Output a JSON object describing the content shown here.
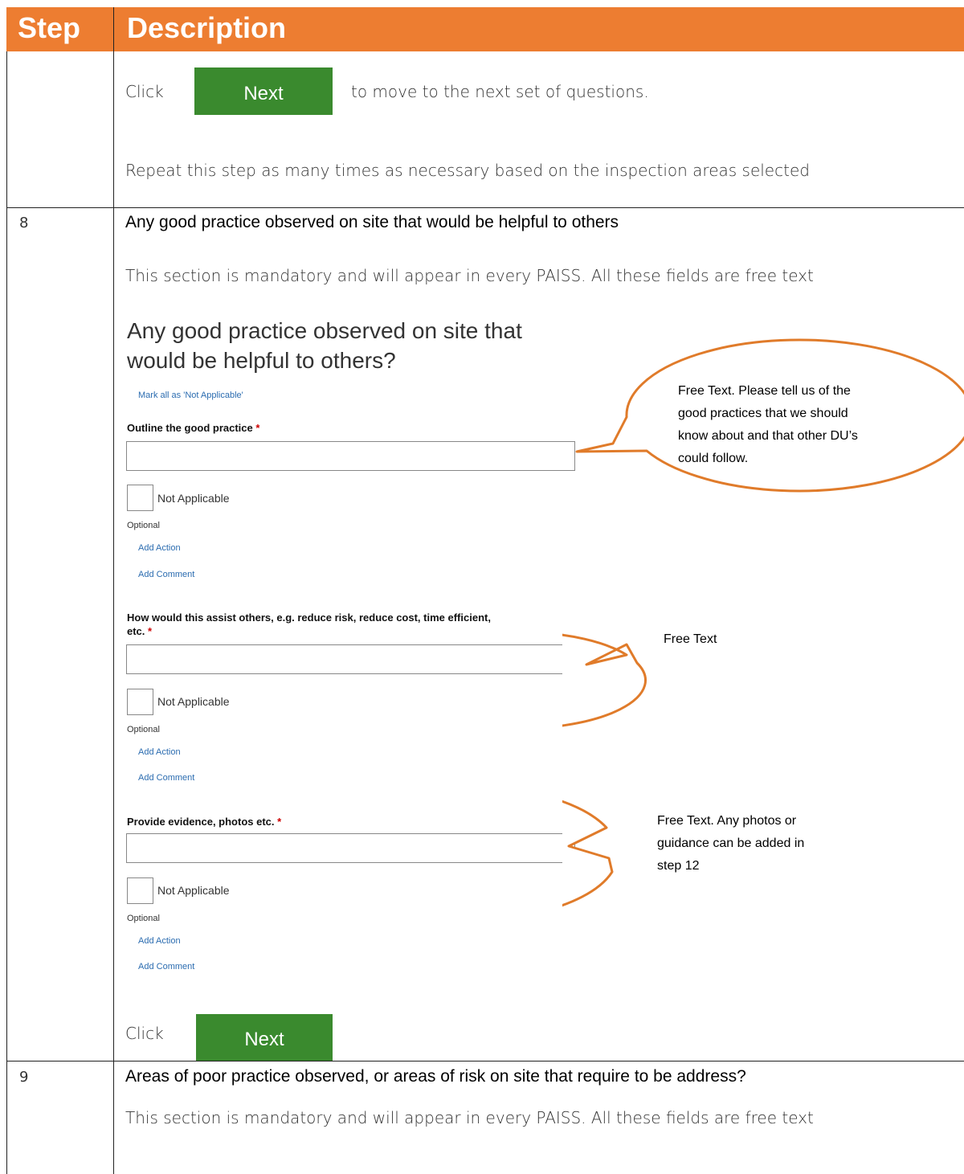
{
  "header": {
    "step": "Step",
    "description": "Description"
  },
  "row_intro": {
    "click": "Click",
    "next": "Next",
    "after": "to move to the next set of questions.",
    "repeat": "Repeat this step as many times as necessary based on the inspection areas selected"
  },
  "row8": {
    "step": "8",
    "heading": "Any good practice observed on site that would be helpful to others",
    "intro": "This section is mandatory and will appear in every PAISS.  All these fields are free text",
    "form": {
      "title_line1": "Any good practice observed on site that",
      "title_line2": "would be helpful to others?",
      "mark_all": "Mark all as 'Not Applicable'",
      "questions": [
        {
          "label": "Outline the good practice",
          "na": "Not Applicable",
          "optional": "Optional",
          "add_action": "Add Action",
          "add_comment": "Add Comment"
        },
        {
          "label_line1": "How would this assist others, e.g. reduce risk, reduce cost, time efficient,",
          "label_line2": "etc.",
          "na": "Not Applicable",
          "optional": "Optional",
          "add_action": "Add Action",
          "add_comment": "Add Comment"
        },
        {
          "label": "Provide evidence, photos etc.",
          "na": "Not Applicable",
          "optional": "Optional",
          "add_action": "Add Action",
          "add_comment": "Add Comment"
        }
      ],
      "required_mark": "*"
    },
    "callouts": [
      {
        "lines": [
          "Free Text.  Please tell us of the",
          "good practices that we should",
          "know about and that other DU’s",
          "could follow."
        ]
      },
      {
        "lines": [
          "Free Text"
        ]
      },
      {
        "lines": [
          "Free Text.  Any photos or",
          "guidance can be added in",
          "step 12"
        ]
      }
    ],
    "click": "Click",
    "next": "Next"
  },
  "row9": {
    "step": "9",
    "heading": "Areas of poor practice observed, or areas of risk on site that require to be address?",
    "intro": "This section is mandatory and will appear in every PAISS.  All these fields are free text"
  },
  "colors": {
    "header": "#ED7D31",
    "next_button": "#3A8A2E",
    "callout_border": "#E07B2A",
    "link": "#2b6cb0"
  }
}
